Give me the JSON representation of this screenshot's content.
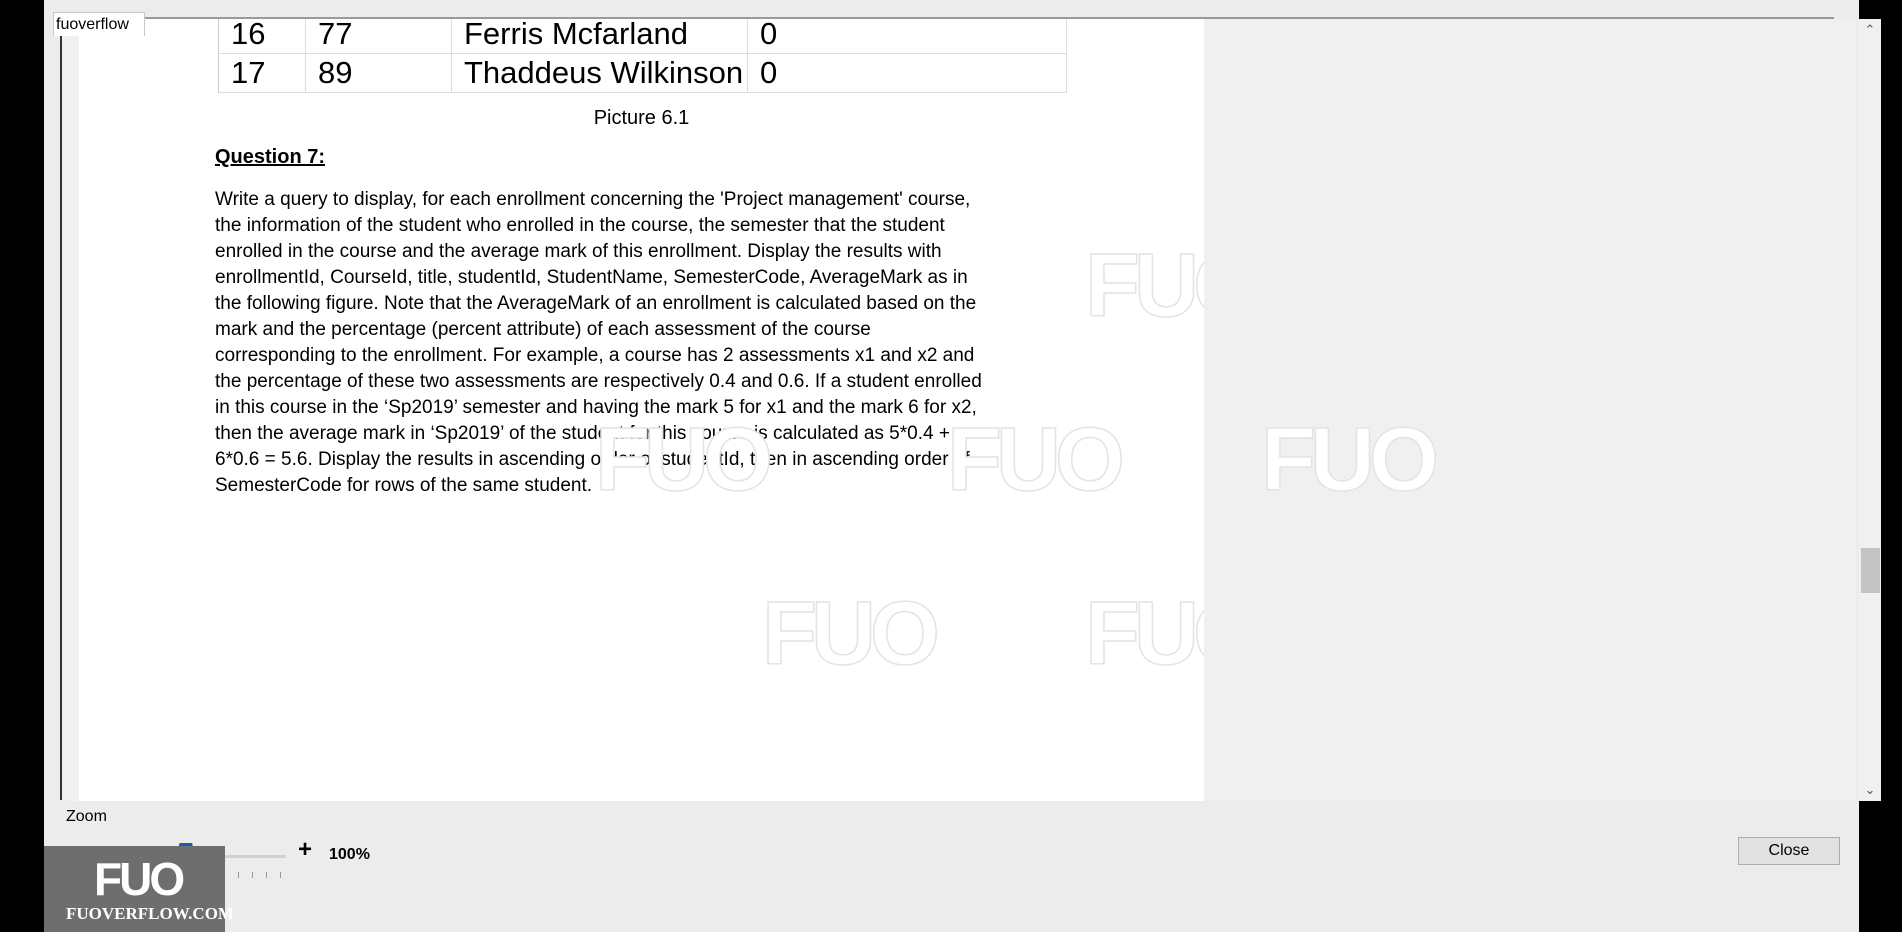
{
  "window": {
    "tab_title": "fuoverflow"
  },
  "table": {
    "rows": [
      [
        "16",
        "77",
        "Ferris Mcfarland",
        "0"
      ],
      [
        "17",
        "89",
        "Thaddeus Wilkinson",
        "0"
      ]
    ]
  },
  "document": {
    "caption": "Picture 6.1",
    "question_title": "Question 7:",
    "question_lines": [
      "Write a query to display, for each enrollment concerning the 'Project management' course,",
      "the information of the student who enrolled in the course, the semester that the student",
      "enrolled in the course and the average mark of this enrollment. Display the results with",
      "enrollmentId, CourseId, title, studentId, StudentName, SemesterCode, AverageMark as in",
      "the following figure. Note that the AverageMark of an enrollment is calculated based on the",
      "mark and the percentage (percent attribute) of each assessment of the course",
      "corresponding to the enrollment. For example, a course has 2 assessments x1 and x2 and",
      "the percentage of these two assessments are respectively 0.4 and 0.6. If a student enrolled",
      "in this course in the ‘Sp2019’ semester and having the mark 5 for x1 and the mark 6 for x2,",
      "then the average mark in ‘Sp2019’ of the student for this course is calculated as 5*0.4 +",
      "6*0.6 = 5.6. Display the results in ascending order of studentId, then in ascending order of",
      "SemesterCode for rows of the same student."
    ],
    "watermark": "FUO"
  },
  "scrollbar": {
    "up_icon": "▲",
    "down_icon": "▼",
    "up": "⌃",
    "down": "⌄"
  },
  "zoom": {
    "label": "Zoom",
    "minus": "-",
    "plus": "+",
    "value": "100%",
    "level_fraction": 0.25
  },
  "logo": {
    "mark": "FUO",
    "site": "FUOVERFLOW.COM"
  },
  "buttons": {
    "close": "Close"
  }
}
